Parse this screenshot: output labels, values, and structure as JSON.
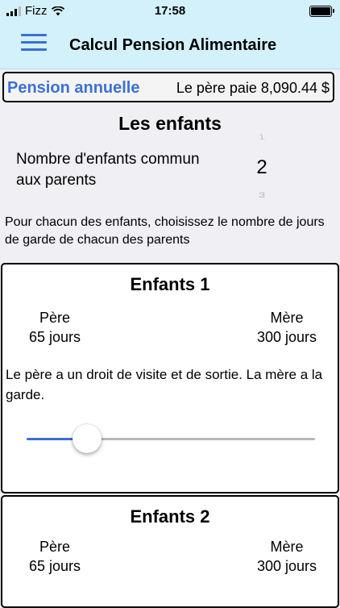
{
  "status_bar": {
    "carrier": "Fizz",
    "time": "17:58"
  },
  "header": {
    "title": "Calcul Pension Alimentaire",
    "menu_icon": "hamburger-icon",
    "accent": "#3b6fd4"
  },
  "summary": {
    "label": "Pension annuelle",
    "value": "Le père paie 8,090.44 $"
  },
  "children_section": {
    "title": "Les enfants",
    "count_label": "Nombre d'enfants commun aux parents",
    "picker": {
      "prev": "1",
      "selected": "2",
      "next": "3"
    },
    "instructions": "Pour chacun des enfants, choisissez le nombre de jours de garde de chacun des parents"
  },
  "cards": [
    {
      "title": "Enfants 1",
      "father_label": "Père",
      "father_days": "65 jours",
      "mother_label": "Mère",
      "mother_days": "300 jours",
      "description": "Le père a un droit de visite et de sortie. La mère a la garde.",
      "slider_fraction": 0.21
    },
    {
      "title": "Enfants 2",
      "father_label": "Père",
      "father_days": "65 jours",
      "mother_label": "Mère",
      "mother_days": "300 jours"
    }
  ]
}
